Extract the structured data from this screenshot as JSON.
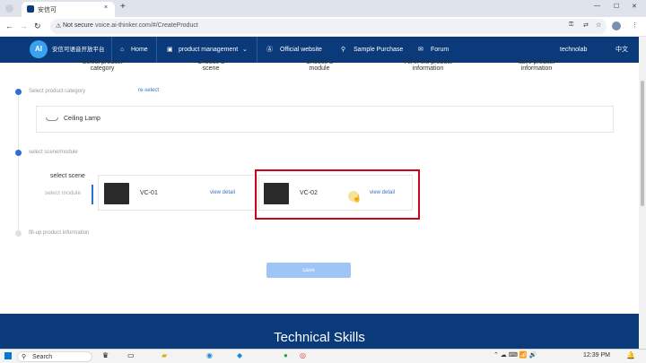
{
  "browser": {
    "tab_title": "安信可",
    "new_tab_glyph": "+",
    "security_label": "Not secure",
    "url": "voice.ai-thinker.com/#/CreateProduct"
  },
  "nav": {
    "logo_text": "AI",
    "brand": "安信可语音开放平台",
    "items": [
      "Home",
      "product management",
      "Official website",
      "Sample Purchase",
      "Forum"
    ],
    "user": "technolab",
    "language": "中文"
  },
  "steps": [
    [
      "Select product",
      "category"
    ],
    [
      "Choose a",
      "scene"
    ],
    [
      "Choose a",
      "module"
    ],
    [
      "Fill in the product",
      "information"
    ],
    [
      "save product",
      "information"
    ]
  ],
  "content": {
    "select_category_label": "Select product category",
    "reselect": "re-select",
    "category_value": "Ceiling Lamp",
    "select_scene_module_label": "select scene/module",
    "tab_scene": "select scene",
    "tab_module": "select module",
    "modules": [
      {
        "name": "VC-01",
        "detail": "view detail"
      },
      {
        "name": "VC-02",
        "detail": "view detail"
      }
    ],
    "fillup_label": "fill-up product information",
    "save_button": "save"
  },
  "footer": {
    "title": "Technical Skills"
  },
  "taskbar": {
    "search": "Search",
    "time": "12:39 PM"
  },
  "colors": {
    "nav_bg": "#0a3a7a",
    "accent": "#3b6fc4",
    "highlight_box": "#d0021b",
    "save_button": "#9ec5f5"
  }
}
